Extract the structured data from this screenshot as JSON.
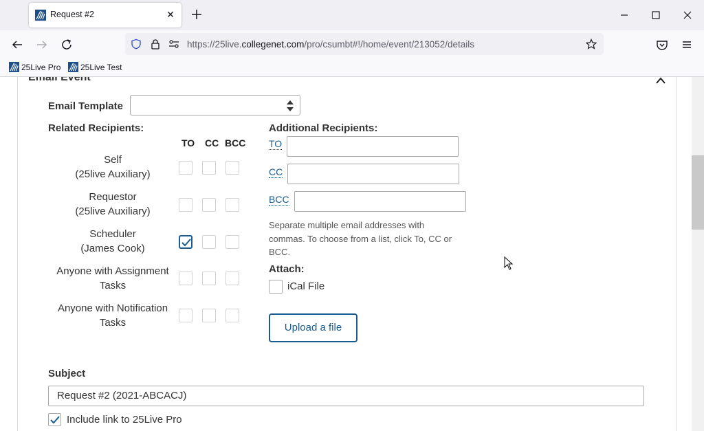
{
  "browser": {
    "tab_title": "Request #2",
    "url_prefix": "https://25live.",
    "url_domain": "collegenet.com",
    "url_path": "/pro/csumbt#!/home/event/213052/details",
    "bookmarks": [
      "25Live Pro",
      "25Live Test"
    ]
  },
  "section": {
    "title": "Email Event"
  },
  "email_template": {
    "label": "Email Template",
    "value": ""
  },
  "related": {
    "heading": "Related Recipients:",
    "col_to": "TO",
    "col_cc": "CC",
    "col_bcc": "BCC",
    "rows": [
      {
        "line1": "Self",
        "line2": "(25live Auxiliary)",
        "to": false,
        "cc": false,
        "bcc": false
      },
      {
        "line1": "Requestor",
        "line2": "(25live Auxiliary)",
        "to": false,
        "cc": false,
        "bcc": false
      },
      {
        "line1": "Scheduler",
        "line2": "(James Cook)",
        "to": true,
        "cc": false,
        "bcc": false
      },
      {
        "line1": "Anyone with Assignment",
        "line2": "Tasks",
        "to": false,
        "cc": false,
        "bcc": false
      },
      {
        "line1": "Anyone with Notification",
        "line2": "Tasks",
        "to": false,
        "cc": false,
        "bcc": false
      }
    ]
  },
  "additional": {
    "heading": "Additional Recipients:",
    "to_label": "TO",
    "cc_label": "CC",
    "bcc_label": "BCC",
    "hint": "Separate multiple email addresses with commas. To choose from a list, click To, CC or BCC."
  },
  "attach": {
    "heading": "Attach:",
    "ical_label": "iCal File",
    "ical_checked": false,
    "upload_label": "Upload a file"
  },
  "subject": {
    "label": "Subject",
    "value": "Request #2 (2021-ABCACJ)"
  },
  "include_link": {
    "label": "Include link to 25Live Pro",
    "checked": true
  },
  "colors": {
    "accent": "#1a5c8f"
  }
}
